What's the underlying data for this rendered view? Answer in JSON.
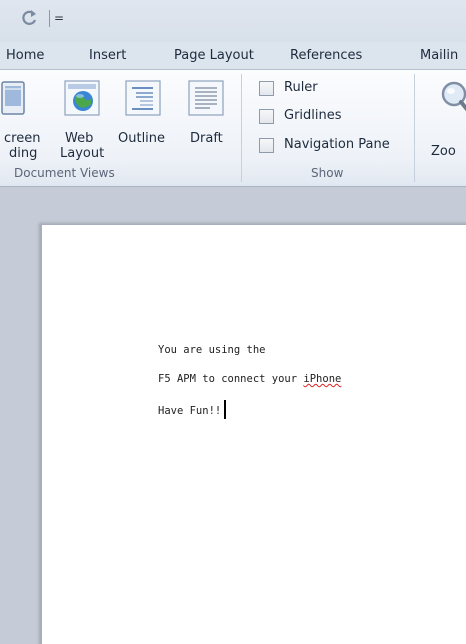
{
  "qat": {
    "redo_icon": "redo-arrow",
    "customize_glyph": "="
  },
  "tabs": [
    "Home",
    "Insert",
    "Page Layout",
    "References",
    "Mailin"
  ],
  "ribbon": {
    "document_views": {
      "label": "Document Views",
      "buttons": [
        {
          "line1": "creen",
          "line2": "ding",
          "icon": "full-screen-reading-icon"
        },
        {
          "line1": "Web",
          "line2": "Layout",
          "icon": "web-layout-icon"
        },
        {
          "line1": "Outline",
          "line2": "",
          "icon": "outline-icon"
        },
        {
          "line1": "Draft",
          "line2": "",
          "icon": "draft-icon"
        }
      ]
    },
    "show": {
      "label": "Show",
      "checkboxes": [
        {
          "label": "Ruler",
          "checked": false
        },
        {
          "label": "Gridlines",
          "checked": false
        },
        {
          "label": "Navigation Pane",
          "checked": false
        }
      ]
    },
    "zoom": {
      "label": "Zoo",
      "icon": "magnifier-icon"
    }
  },
  "document": {
    "lines": [
      "You are using the",
      "F5 APM to connect your ",
      "Have Fun!!"
    ],
    "misspelled_word": "iPhone"
  }
}
